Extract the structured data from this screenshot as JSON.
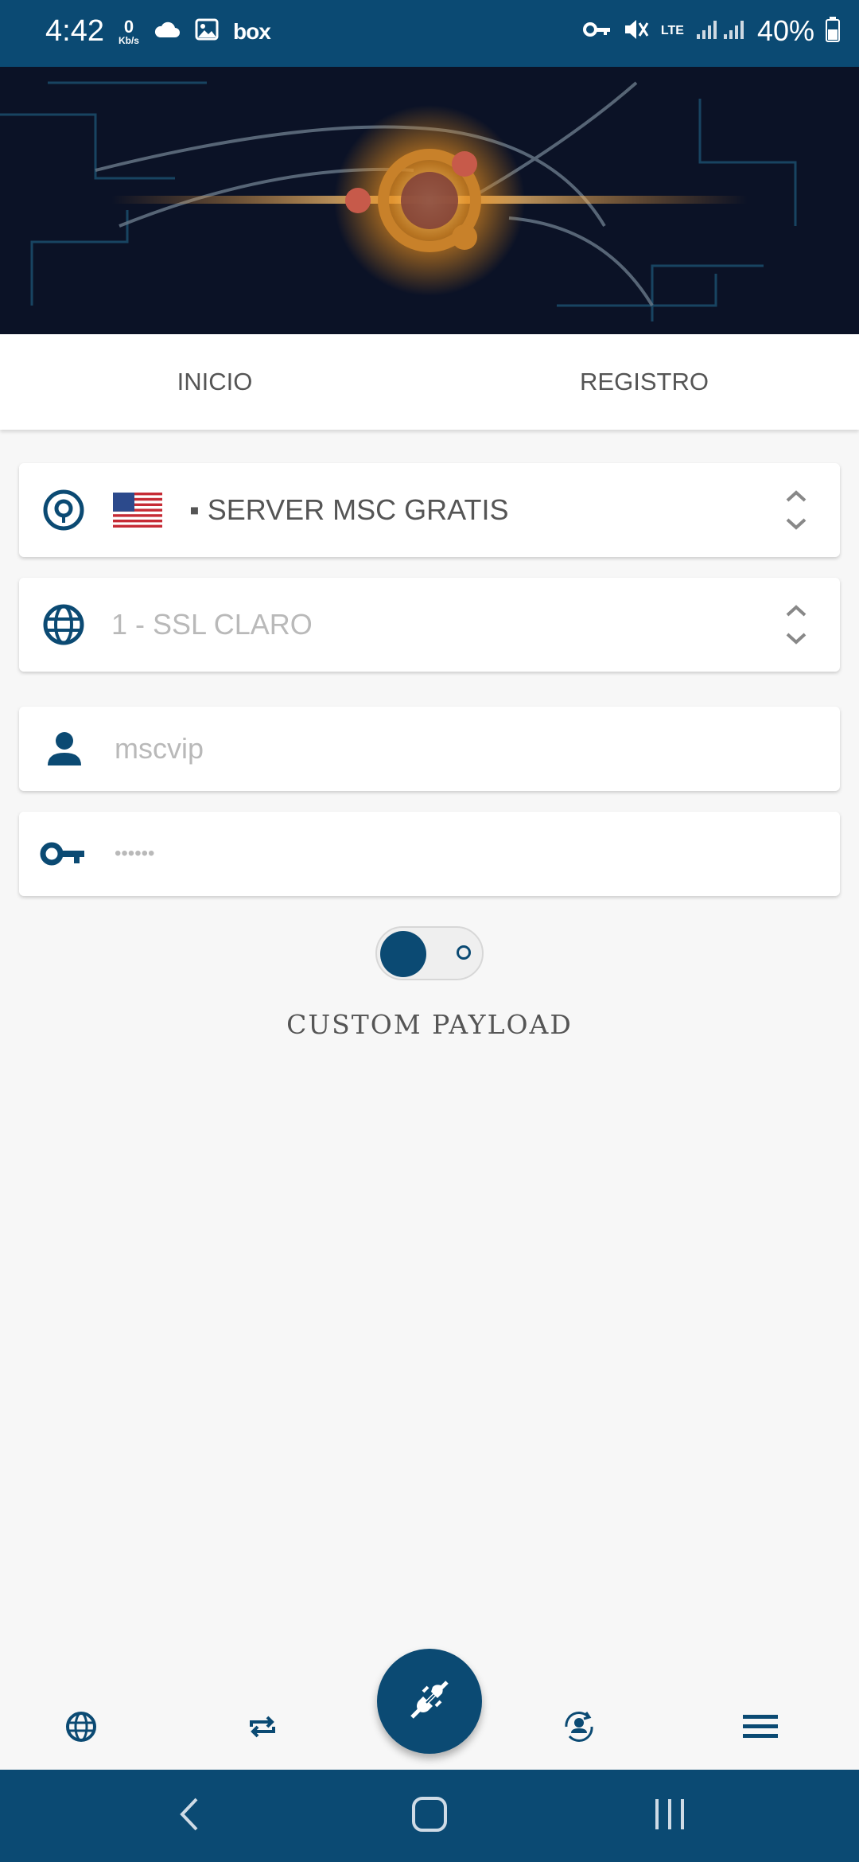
{
  "status_bar": {
    "time": "4:42",
    "speed_value": "0",
    "speed_unit": "Kb/s",
    "app_label": "box",
    "network": "LTE",
    "battery": "40%",
    "icons": [
      "cloud-icon",
      "image-icon",
      "vpn-key-icon",
      "mute-icon",
      "signal-icon",
      "battery-icon"
    ]
  },
  "tabs": [
    {
      "label": "INICIO"
    },
    {
      "label": "REGISTRO"
    }
  ],
  "server_selector": {
    "value": "▪ SERVER MSC GRATIS",
    "flag": "us-flag"
  },
  "payload_selector": {
    "value": "1 - SSL CLARO"
  },
  "username": {
    "placeholder": "mscvip"
  },
  "password": {
    "placeholder": "••••••"
  },
  "custom_payload": {
    "label": "CUSTOM PAYLOAD",
    "enabled": false
  },
  "bottom_nav": {
    "items": [
      "globe-icon",
      "repeat-icon",
      "plug-icon",
      "person-sync-icon",
      "menu-icon"
    ]
  },
  "colors": {
    "primary": "#0b4a73",
    "background": "#f7f7f7"
  }
}
